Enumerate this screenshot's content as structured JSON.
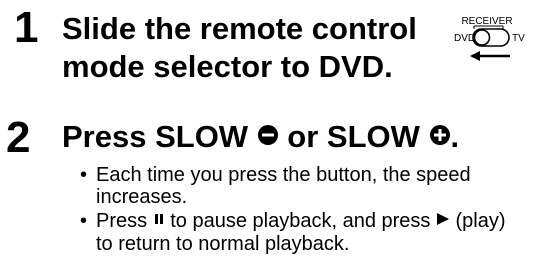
{
  "steps": [
    {
      "number": "1",
      "text": "Slide the remote control mode selector to DVD."
    },
    {
      "number": "2",
      "prefix": "Press SLOW ",
      "middle": " or SLOW ",
      "suffix": "."
    }
  ],
  "bullets": [
    {
      "text": "Each time you press the button, the speed increases."
    },
    {
      "before": "Press ",
      "middle": " to pause playback, and press ",
      "after": " (play) to return to normal playback."
    }
  ],
  "selector": {
    "top_label": "RECEIVER",
    "left_label": "DVD",
    "right_label": "TV"
  },
  "icons": {
    "slow_minus": "minus-circle-icon",
    "slow_plus": "plus-circle-icon",
    "pause": "pause-icon",
    "play": "play-icon",
    "selector_arrow": "left-arrow-icon"
  }
}
